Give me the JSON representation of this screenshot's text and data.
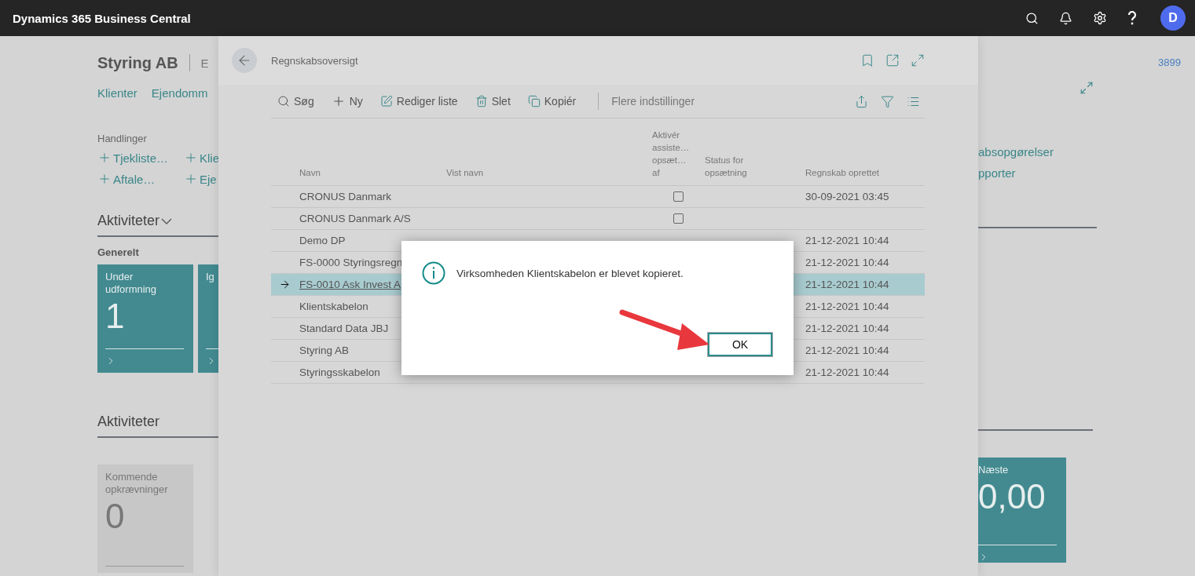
{
  "app_bar": {
    "title": "Dynamics 365 Business Central",
    "avatar": "D"
  },
  "background": {
    "company": "Styring AB",
    "company_tab": "E",
    "nav": [
      "Klienter",
      "Ejendomm"
    ],
    "actions_title": "Handlinger",
    "actions": [
      "Tjekliste…",
      "Klie",
      "Aftale…",
      "Eje"
    ],
    "activities_1": {
      "title": "Aktiviteter",
      "group": "Generelt",
      "tiles": [
        {
          "label": "Under udformning",
          "value": "1"
        },
        {
          "label": "Ig"
        }
      ]
    },
    "activities_2": {
      "title": "Aktiviteter",
      "tiles": [
        {
          "label": "Kommende opkrævninger",
          "value": "0"
        }
      ]
    },
    "right": {
      "count": "3899",
      "links": [
        "absopgørelser",
        "pporter"
      ],
      "tile": {
        "label": "Næste",
        "value": "0,00"
      }
    }
  },
  "panel": {
    "title": "Regnskabsoversigt",
    "toolbar": [
      {
        "kind": "search",
        "label": "Søg"
      },
      {
        "kind": "new",
        "label": "Ny"
      },
      {
        "kind": "edit",
        "label": "Rediger liste"
      },
      {
        "kind": "delete",
        "label": "Slet"
      },
      {
        "kind": "copy",
        "label": "Kopiér"
      }
    ],
    "more": "Flere indstillinger",
    "table": {
      "columns": [
        "Navn",
        "Vist navn",
        "Aktivér assiste… opsæt… af",
        "Status for opsætning",
        "Regnskab oprettet"
      ],
      "rows": [
        {
          "name": "CRONUS Danmark",
          "checked": false,
          "created": "30-09-2021 03:45",
          "selected": false
        },
        {
          "name": "CRONUS Danmark A/S",
          "checked": false,
          "selected": false
        },
        {
          "name": "Demo DP",
          "created": "21-12-2021 10:44",
          "selected": false
        },
        {
          "name": "FS-0000 Styringsregn",
          "created": "21-12-2021 10:44",
          "selected": false
        },
        {
          "name": "FS-0010 Ask Invest A",
          "created": "21-12-2021 10:44",
          "selected": true
        },
        {
          "name": "Klientskabelon",
          "created": "21-12-2021 10:44",
          "selected": false
        },
        {
          "name": "Standard Data JBJ",
          "created": "21-12-2021 10:44",
          "selected": false
        },
        {
          "name": "Styring AB",
          "created": "21-12-2021 10:44",
          "selected": false
        },
        {
          "name": "Styringsskabelon",
          "created": "21-12-2021 10:44",
          "selected": false
        }
      ]
    }
  },
  "dialog": {
    "message": "Virksomheden Klientskabelon er blevet kopieret.",
    "button": "OK"
  }
}
